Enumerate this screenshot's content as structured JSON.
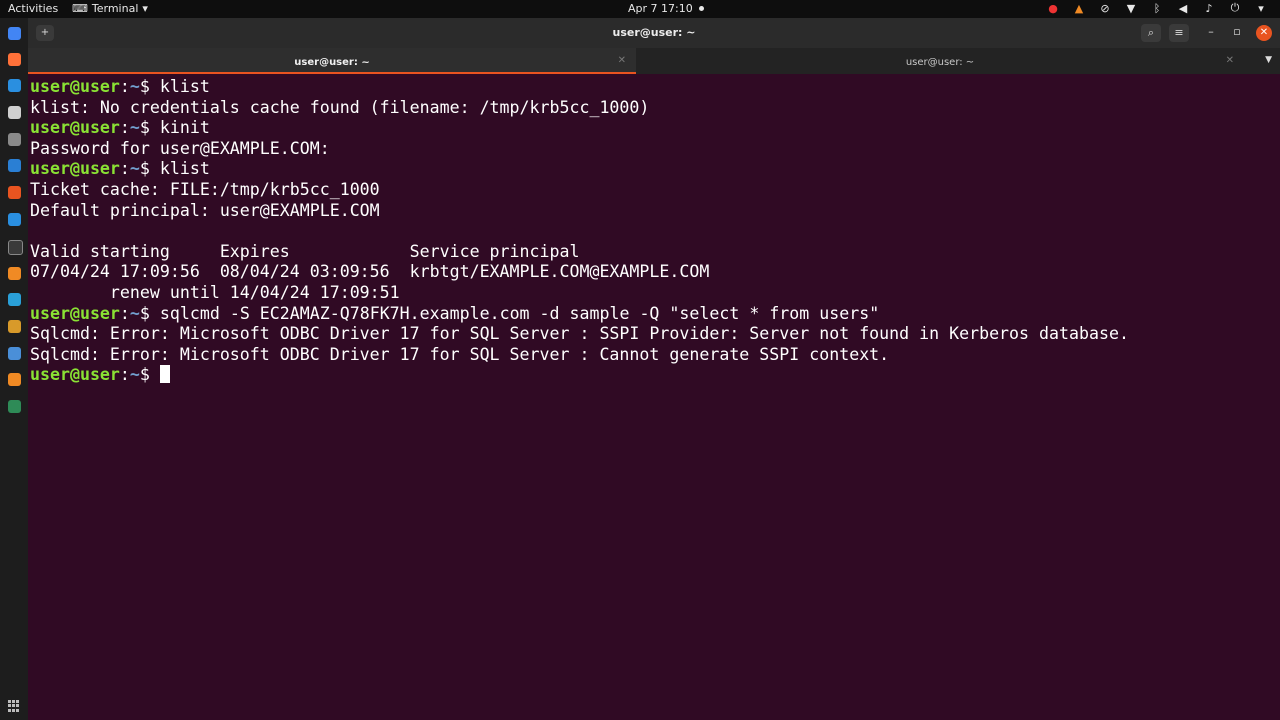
{
  "topbar": {
    "activities": "Activities",
    "app_menu": "Terminal",
    "clock": "Apr 7  17:10"
  },
  "window": {
    "title": "user@user: ~",
    "tabs": [
      {
        "label": "user@user: ~",
        "active": true
      },
      {
        "label": "user@user: ~",
        "active": false
      }
    ]
  },
  "prompt": {
    "user": "user@user",
    "sep": ":",
    "path": "~",
    "sym": "$ "
  },
  "terminal": {
    "lines": [
      {
        "prompt": true,
        "cmd": "klist"
      },
      {
        "prompt": false,
        "text": "klist: No credentials cache found (filename: /tmp/krb5cc_1000)"
      },
      {
        "prompt": true,
        "cmd": "kinit"
      },
      {
        "prompt": false,
        "text": "Password for user@EXAMPLE.COM:"
      },
      {
        "prompt": true,
        "cmd": "klist"
      },
      {
        "prompt": false,
        "text": "Ticket cache: FILE:/tmp/krb5cc_1000"
      },
      {
        "prompt": false,
        "text": "Default principal: user@EXAMPLE.COM"
      },
      {
        "prompt": false,
        "text": ""
      },
      {
        "prompt": false,
        "text": "Valid starting     Expires            Service principal"
      },
      {
        "prompt": false,
        "text": "07/04/24 17:09:56  08/04/24 03:09:56  krbtgt/EXAMPLE.COM@EXAMPLE.COM"
      },
      {
        "prompt": false,
        "text": "        renew until 14/04/24 17:09:51"
      },
      {
        "prompt": true,
        "cmd": "sqlcmd -S EC2AMAZ-Q78FK7H.example.com -d sample -Q \"select * from users\""
      },
      {
        "prompt": false,
        "text": "Sqlcmd: Error: Microsoft ODBC Driver 17 for SQL Server : SSPI Provider: Server not found in Kerberos database."
      },
      {
        "prompt": false,
        "text": "Sqlcmd: Error: Microsoft ODBC Driver 17 for SQL Server : Cannot generate SSPI context."
      },
      {
        "prompt": true,
        "cmd": "",
        "cursor": true
      }
    ]
  },
  "icons": {
    "dock": [
      "chrome-icon",
      "firefox-icon",
      "vscode-icon",
      "files-icon",
      "settings-icon",
      "libreoffice-writer-icon",
      "software-icon",
      "help-icon",
      "terminal-icon",
      "sublime-icon",
      "disk-icon",
      "app-icon",
      "app-icon",
      "vlc-icon",
      "app-icon"
    ],
    "colors": [
      "#4285f4",
      "#ff7139",
      "#2a8fe0",
      "#cfcfcf",
      "#8a8a8a",
      "#2a7fd4",
      "#e95420",
      "#2a8fe0",
      "#3a3a3a",
      "#f08a24",
      "#2aa0d8",
      "#d89a2a",
      "#4a8fd8",
      "#f08a24",
      "#2e8b57"
    ]
  },
  "colors": {
    "background": "#300a24",
    "prompt_user": "#8ae234",
    "prompt_path": "#729fcf",
    "accent": "#e95420"
  }
}
